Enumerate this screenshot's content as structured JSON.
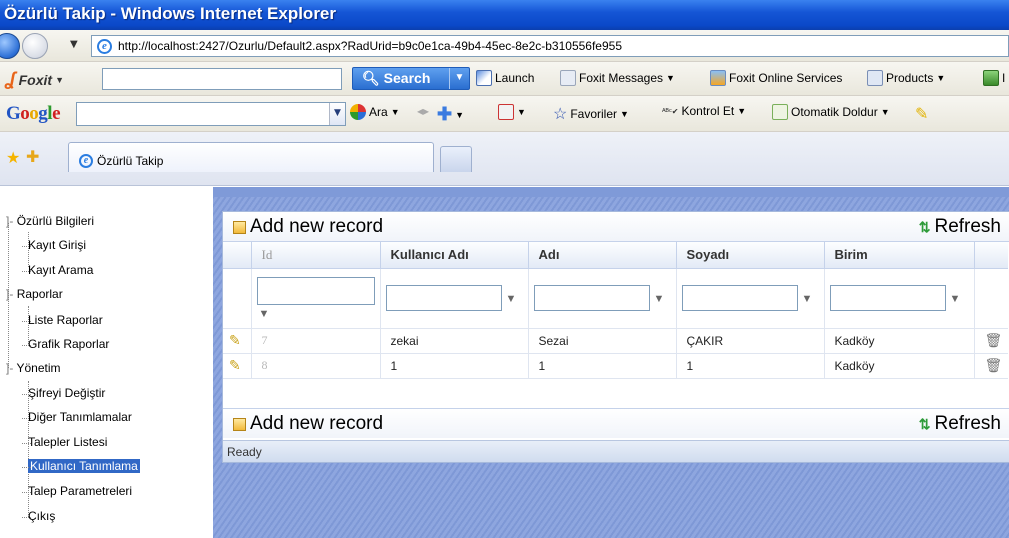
{
  "window": {
    "title": "Özürlü Takip - Windows Internet Explorer"
  },
  "address": {
    "url": "http://localhost:2427/Ozurlu/Default2.aspx?RadUrid=b9c0e1ca-49b4-45ec-8e2c-b310556fe955"
  },
  "foxit_toolbar": {
    "logo": "Foxit",
    "search_label": "Search",
    "items": [
      "Launch",
      "Foxit Messages",
      "Foxit Online Services",
      "Products"
    ],
    "overflow": "I"
  },
  "google_toolbar": {
    "logo": "Google",
    "search_label": "Ara",
    "favorites": "Favoriler",
    "spellcheck": "Kontrol Et",
    "autofill": "Otomatik Doldur"
  },
  "tabs": {
    "active": "Özürlü Takip"
  },
  "tree": {
    "groups": [
      {
        "label": "Özürlü Bilgileri",
        "items": [
          "Kayıt Girişi",
          "Kayıt Arama"
        ]
      },
      {
        "label": "Raporlar",
        "items": [
          "Liste Raporlar",
          "Grafik Raporlar"
        ]
      },
      {
        "label": "Yönetim",
        "items": [
          "Şifreyi Değiştir",
          "Diğer Tanımlamalar",
          "Talepler Listesi",
          "Kullanıcı Tanımlama",
          "Talep Parametreleri",
          "Çıkış"
        ]
      }
    ],
    "selected": "Kullanıcı Tanımlama"
  },
  "grid": {
    "add_label": "Add new record",
    "refresh_label": "Refresh",
    "columns": [
      "Id",
      "Kullanıcı Adı",
      "Adı",
      "Soyadı",
      "Birim"
    ],
    "rows": [
      {
        "id": "7",
        "username": "zekai",
        "name": "Sezai",
        "surname": "ÇAKIR",
        "unit": "Kadköy"
      },
      {
        "id": "8",
        "username": "1",
        "name": "1",
        "surname": "1",
        "unit": "Kadköy"
      }
    ],
    "status": "Ready"
  },
  "colors": {
    "title_bar": "#0a48c8",
    "content_bg": "#8ea6df",
    "selected": "#3168c6"
  }
}
